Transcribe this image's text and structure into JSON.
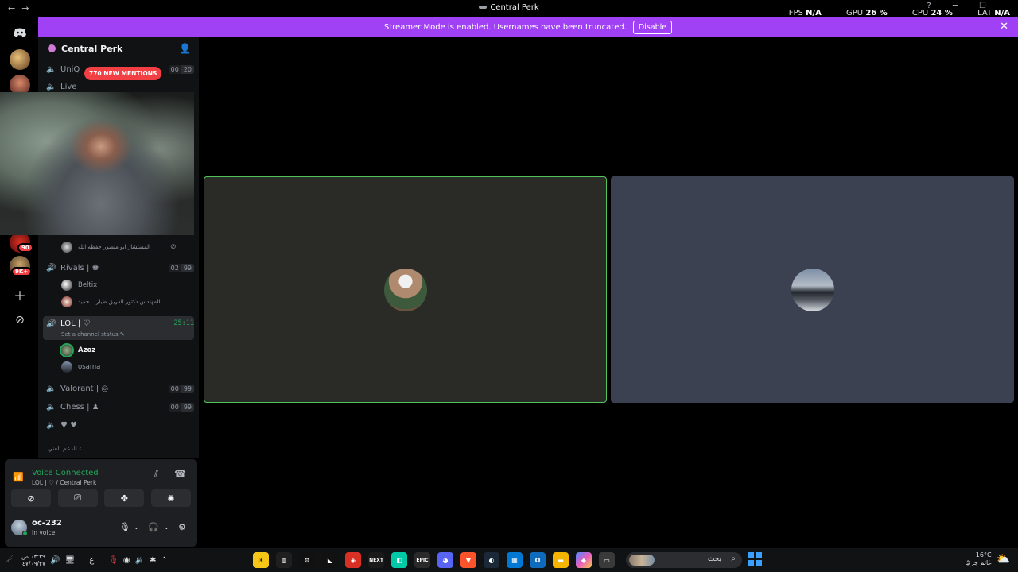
{
  "titlebar": {
    "back": "←",
    "forward": "→",
    "title": "Central Perk",
    "window_controls": "? ─ ☐"
  },
  "overlay_stats": {
    "fps_label": "FPS",
    "fps_value": "N/A",
    "gpu_label": "GPU",
    "gpu_value": "26 %",
    "cpu_label": "CPU",
    "cpu_value": "24 %",
    "lat_label": "LAT",
    "lat_value": "N/A"
  },
  "banner": {
    "text": "Streamer Mode is enabled. Usernames have been truncated.",
    "button": "Disable",
    "close": "✕"
  },
  "guilds": {
    "badge_a3": "90",
    "badge_a4": "9K+"
  },
  "server": {
    "name": "Central Perk",
    "mentions": "770 NEW MENTIONS"
  },
  "channels": [
    {
      "name": "UniQ",
      "count": "00",
      "cap": "20"
    },
    {
      "name": "Live"
    },
    {
      "name": "Rivals | ♚",
      "count": "02",
      "cap": "99"
    },
    {
      "name": "LOL | ♡",
      "timer": "25:11",
      "status": "Set a channel status ✎"
    },
    {
      "name": "Valorant | ◎",
      "count": "00",
      "cap": "99"
    },
    {
      "name": "Chess | ♟",
      "count": "00",
      "cap": "99"
    },
    {
      "name": "♥ ♥"
    }
  ],
  "voice_users": {
    "live_user": "المستشار ابو منصور حفظه الله",
    "rivals": [
      "Beltix",
      "المهندس دكتور الفريق طيار .. حميد"
    ],
    "lol": [
      "Azoz",
      "osama"
    ]
  },
  "section_tail": "الدعم الفني ‹",
  "voice_panel": {
    "title": "Voice Connected",
    "subtitle": "LOL | ♡ / Central Perk"
  },
  "user": {
    "name": "oc-232",
    "status": "In voice"
  },
  "taskbar": {
    "clock_time": "٠٣:٣٩ ص",
    "clock_date": "٤٧/٠٩/٢٧",
    "lang": "ع",
    "app_badge": "3",
    "search_text": "بحث",
    "weather_temp": "16°C",
    "weather_desc": "غائم جزئيًا",
    "apps": [
      {
        "name": "epic-games-icon",
        "label": "EPIC",
        "color": "#2a2a2a"
      },
      {
        "name": "next-icon",
        "label": "NEXT",
        "color": "#1a1a1a"
      }
    ]
  }
}
